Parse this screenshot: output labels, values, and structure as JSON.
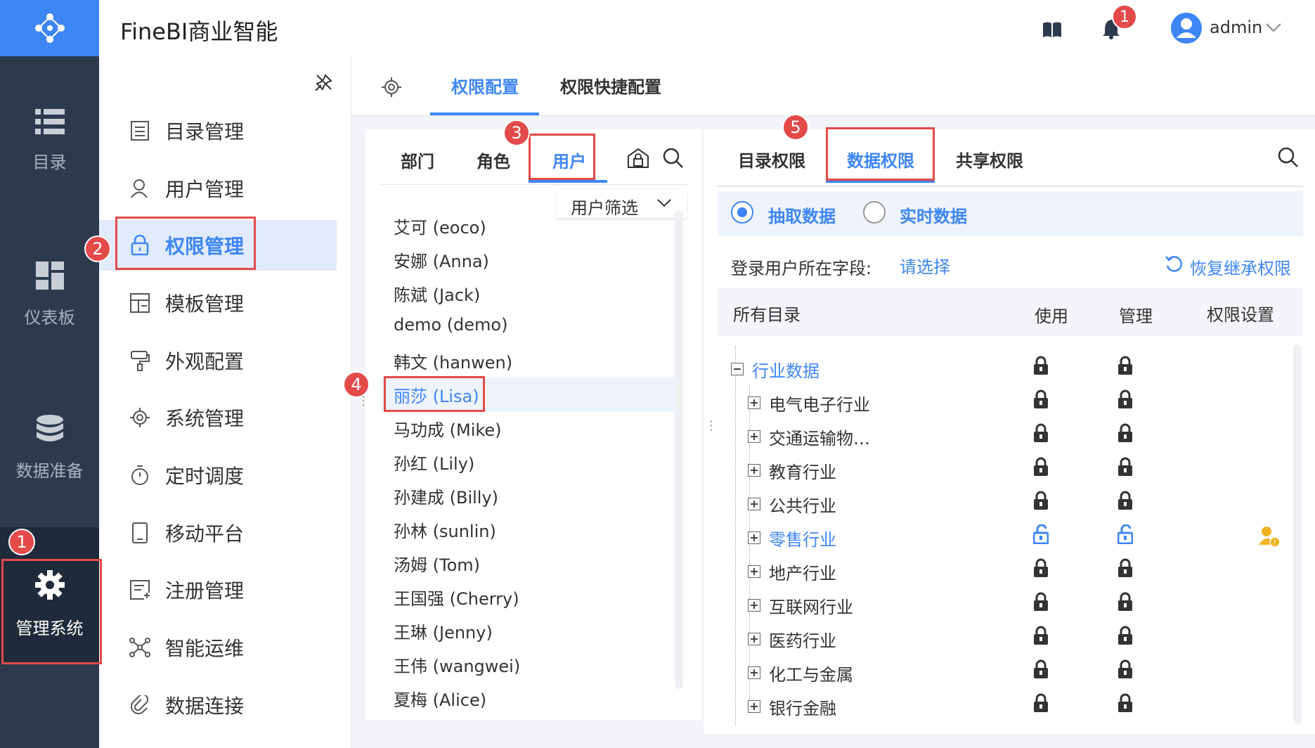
{
  "app": {
    "title": "FineBI商业智能",
    "user": "admin",
    "notification_count": "1"
  },
  "rail": [
    {
      "label": "目录",
      "icon": "list-icon"
    },
    {
      "label": "仪表板",
      "icon": "dashboard-icon"
    },
    {
      "label": "数据准备",
      "icon": "database-icon"
    },
    {
      "label": "管理系统",
      "icon": "gear-icon",
      "active": true
    }
  ],
  "nav": [
    {
      "label": "目录管理",
      "icon": "catalog-icon"
    },
    {
      "label": "用户管理",
      "icon": "user-icon"
    },
    {
      "label": "权限管理",
      "icon": "lock-icon",
      "active": true
    },
    {
      "label": "模板管理",
      "icon": "template-icon"
    },
    {
      "label": "外观配置",
      "icon": "paint-icon"
    },
    {
      "label": "系统管理",
      "icon": "gear-icon"
    },
    {
      "label": "定时调度",
      "icon": "timer-icon"
    },
    {
      "label": "移动平台",
      "icon": "mobile-icon"
    },
    {
      "label": "注册管理",
      "icon": "register-icon"
    },
    {
      "label": "智能运维",
      "icon": "ops-icon"
    },
    {
      "label": "数据连接",
      "icon": "link-icon"
    }
  ],
  "main_tabs": {
    "config": "权限配置",
    "quick": "权限快捷配置"
  },
  "user_panel": {
    "tabs": {
      "dept": "部门",
      "role": "角色",
      "user": "用户"
    },
    "filter": "用户筛选",
    "users": [
      "艾可 (eoco)",
      "安娜 (Anna)",
      "陈斌 (Jack)",
      "demo (demo)",
      "韩文 (hanwen)",
      "丽莎 (Lisa)",
      "马功成 (Mike)",
      "孙红 (Lily)",
      "孙建成 (Billy)",
      "孙林 (sunlin)",
      "汤姆 (Tom)",
      "王国强 (Cherry)",
      "王琳 (Jenny)",
      "王伟 (wangwei)",
      "夏梅 (Alice)"
    ],
    "selected_index": 5
  },
  "perm_panel": {
    "tabs": {
      "catalog": "目录权限",
      "data": "数据权限",
      "share": "共享权限"
    },
    "radio": {
      "extract": "抽取数据",
      "realtime": "实时数据"
    },
    "field_label": "登录用户所在字段:",
    "field_value": "请选择",
    "restore": "恢复继承权限",
    "columns": {
      "all": "所有目录",
      "use": "使用",
      "manage": "管理",
      "setting": "权限设置"
    },
    "tree": [
      {
        "label": "行业数据",
        "root": true,
        "unlocked": false
      },
      {
        "label": "电气电子行业",
        "unlocked": false
      },
      {
        "label": "交通运输物…",
        "unlocked": false
      },
      {
        "label": "教育行业",
        "unlocked": false
      },
      {
        "label": "公共行业",
        "unlocked": false
      },
      {
        "label": "零售行业",
        "unlocked": true
      },
      {
        "label": "地产行业",
        "unlocked": false
      },
      {
        "label": "互联网行业",
        "unlocked": false
      },
      {
        "label": "医药行业",
        "unlocked": false
      },
      {
        "label": "化工与金属",
        "unlocked": false
      },
      {
        "label": "银行金融",
        "unlocked": false
      }
    ]
  },
  "callouts": [
    "1",
    "2",
    "3",
    "4",
    "5"
  ],
  "colors": {
    "accent": "#3e86f5",
    "rail": "#2d3a4e",
    "callout": "#e34a4a",
    "warning": "#f0b323"
  }
}
